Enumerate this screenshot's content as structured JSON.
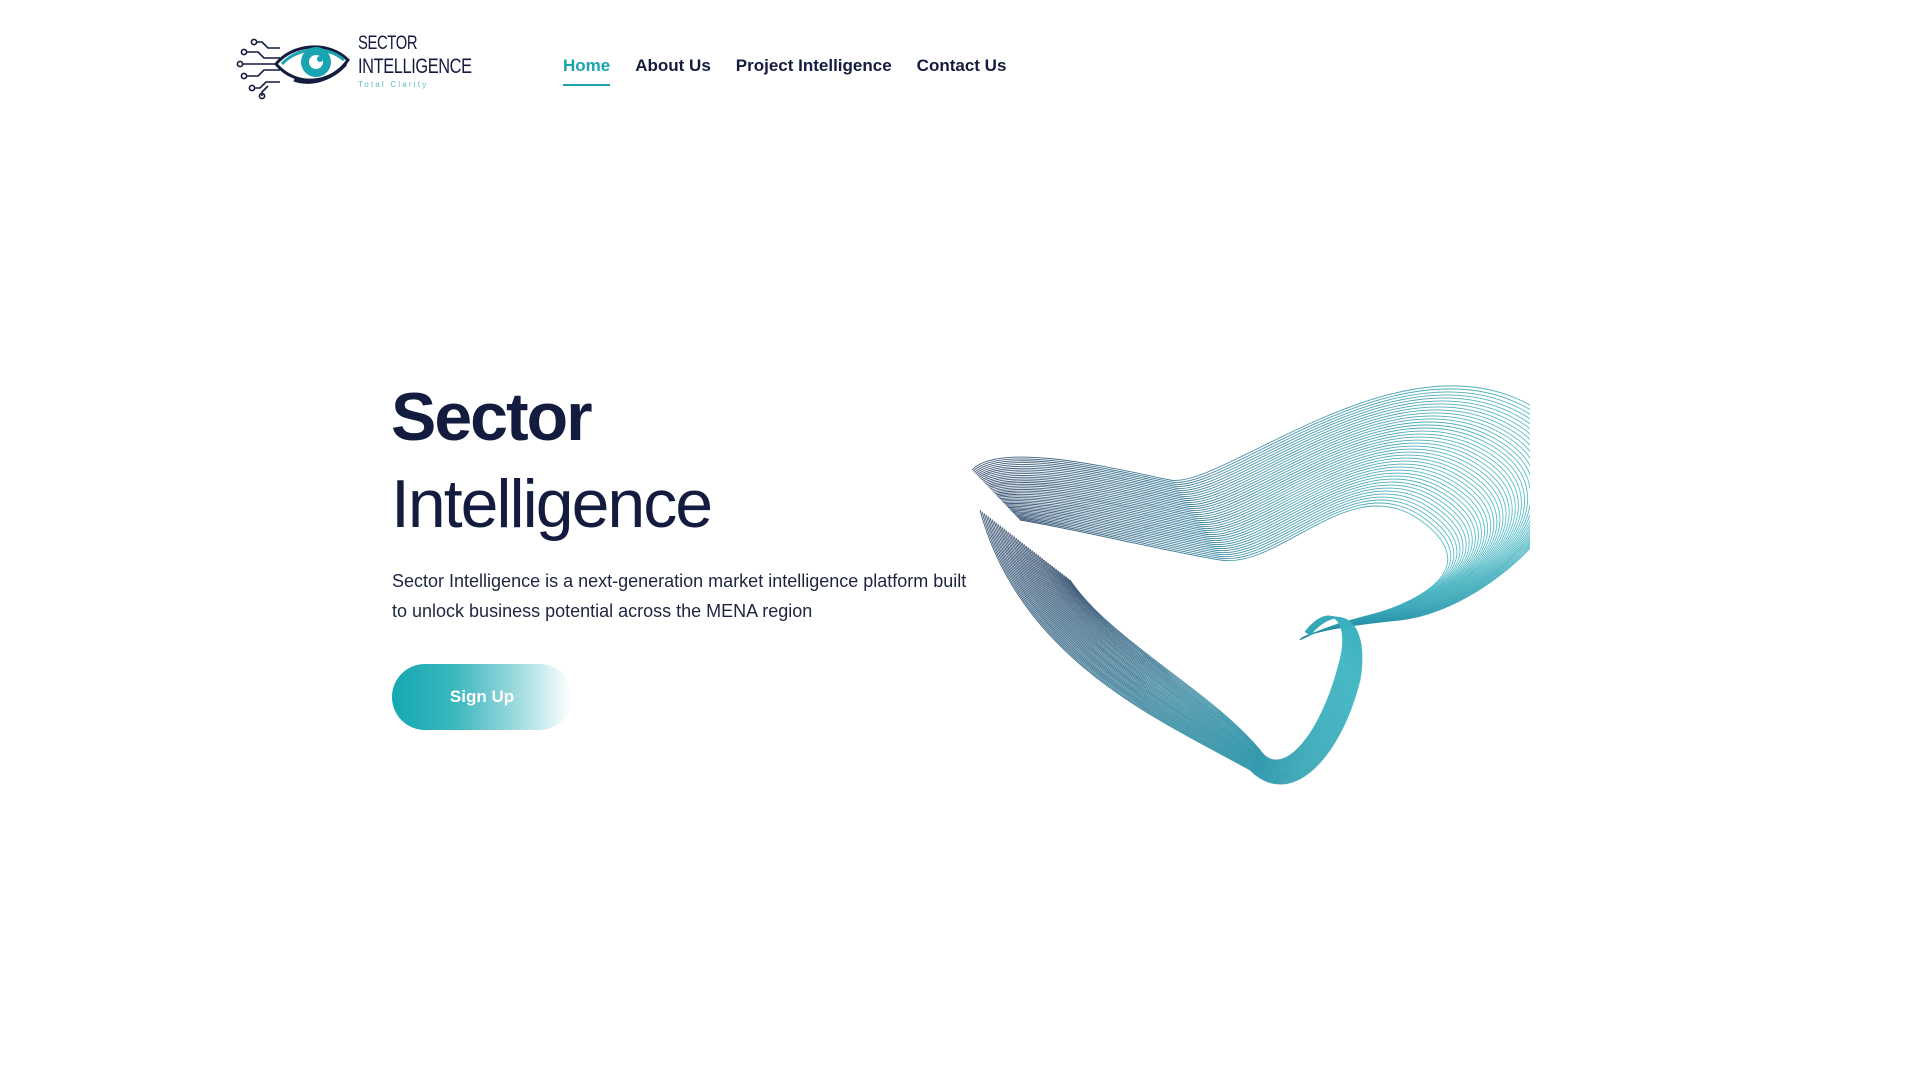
{
  "brand": {
    "name_line1": "SECTOR",
    "name_line2": "INTELLIGENCE",
    "tagline": "Total Clarity",
    "accent_color": "#1aa3b0",
    "navy_color": "#131c3e"
  },
  "nav": {
    "items": [
      {
        "label": "Home",
        "active": true
      },
      {
        "label": "About Us",
        "active": false
      },
      {
        "label": "Project Intelligence",
        "active": false
      },
      {
        "label": "Contact Us",
        "active": false
      }
    ]
  },
  "hero": {
    "title_bold": "Sector",
    "title_light": "Intelligence",
    "description": "Sector Intelligence is a next-generation market intelligence platform built to unlock business potential across the MENA region",
    "cta_label": "Sign Up",
    "illustration": "abstract-wireframe-wave"
  }
}
